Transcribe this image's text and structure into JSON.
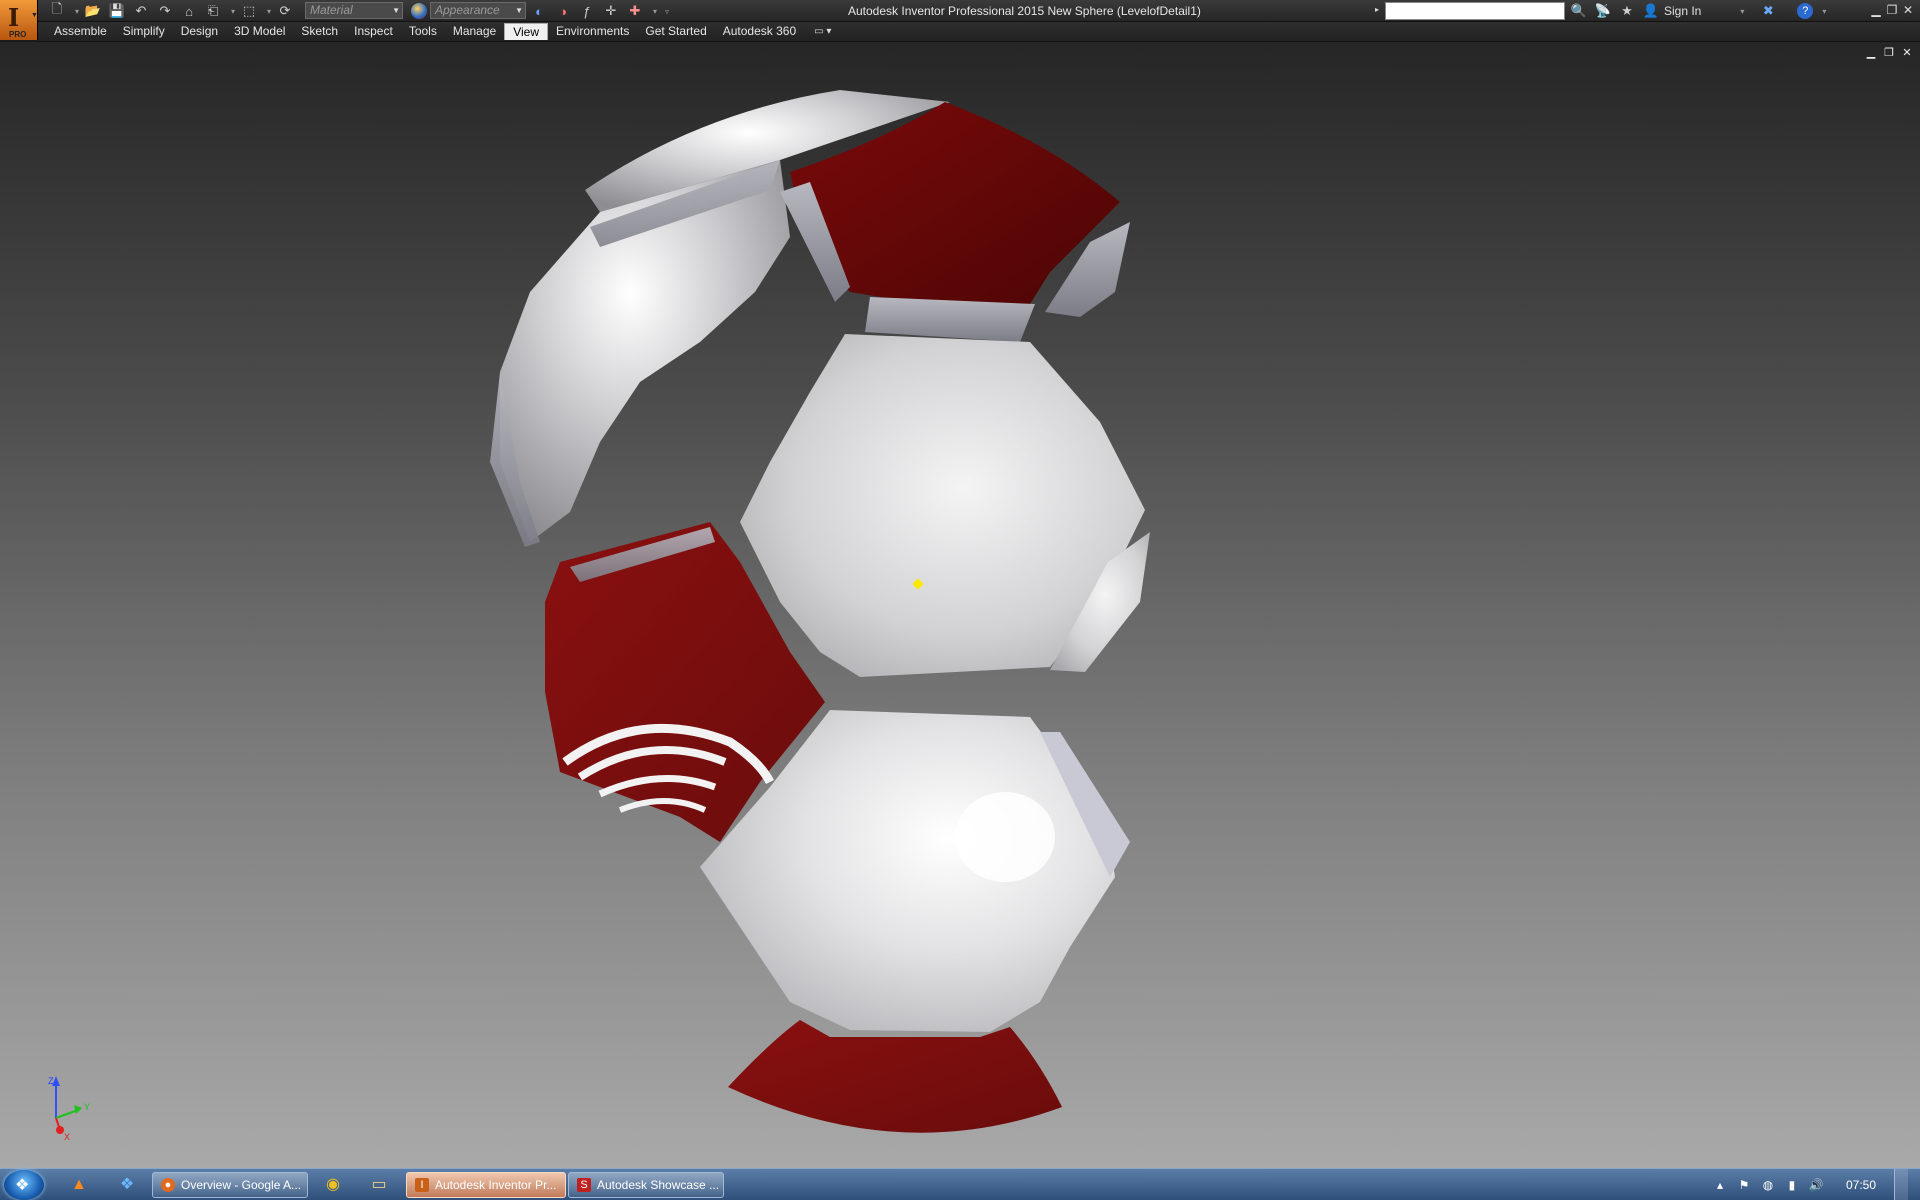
{
  "app": {
    "logo_letter": "I",
    "edition_badge": "PRO",
    "window_title": "Autodesk Inventor Professional 2015    New Sphere (LevelofDetail1)"
  },
  "quick_access": {
    "material_placeholder": "Material",
    "appearance_placeholder": "Appearance"
  },
  "help": {
    "sign_in_label": "Sign In"
  },
  "ribbon": {
    "tabs": [
      {
        "label": "Assemble"
      },
      {
        "label": "Simplify"
      },
      {
        "label": "Design"
      },
      {
        "label": "3D Model"
      },
      {
        "label": "Sketch"
      },
      {
        "label": "Inspect"
      },
      {
        "label": "Tools"
      },
      {
        "label": "Manage"
      },
      {
        "label": "View"
      },
      {
        "label": "Environments"
      },
      {
        "label": "Get Started"
      },
      {
        "label": "Autodesk 360"
      }
    ],
    "active_tab": "View"
  },
  "triad": {
    "z_label": "Z",
    "y_label": "Y",
    "x_label": "X"
  },
  "taskbar": {
    "tasks": [
      {
        "label": "Overview - Google A..."
      },
      {
        "label": "Autodesk Inventor Pr..."
      },
      {
        "label": "Autodesk Showcase ..."
      }
    ],
    "clock": "07:50"
  },
  "colors": {
    "panel_red": "#8a1010",
    "panel_silver": "#d6d6d8",
    "accent_orange": "#e07a20"
  }
}
